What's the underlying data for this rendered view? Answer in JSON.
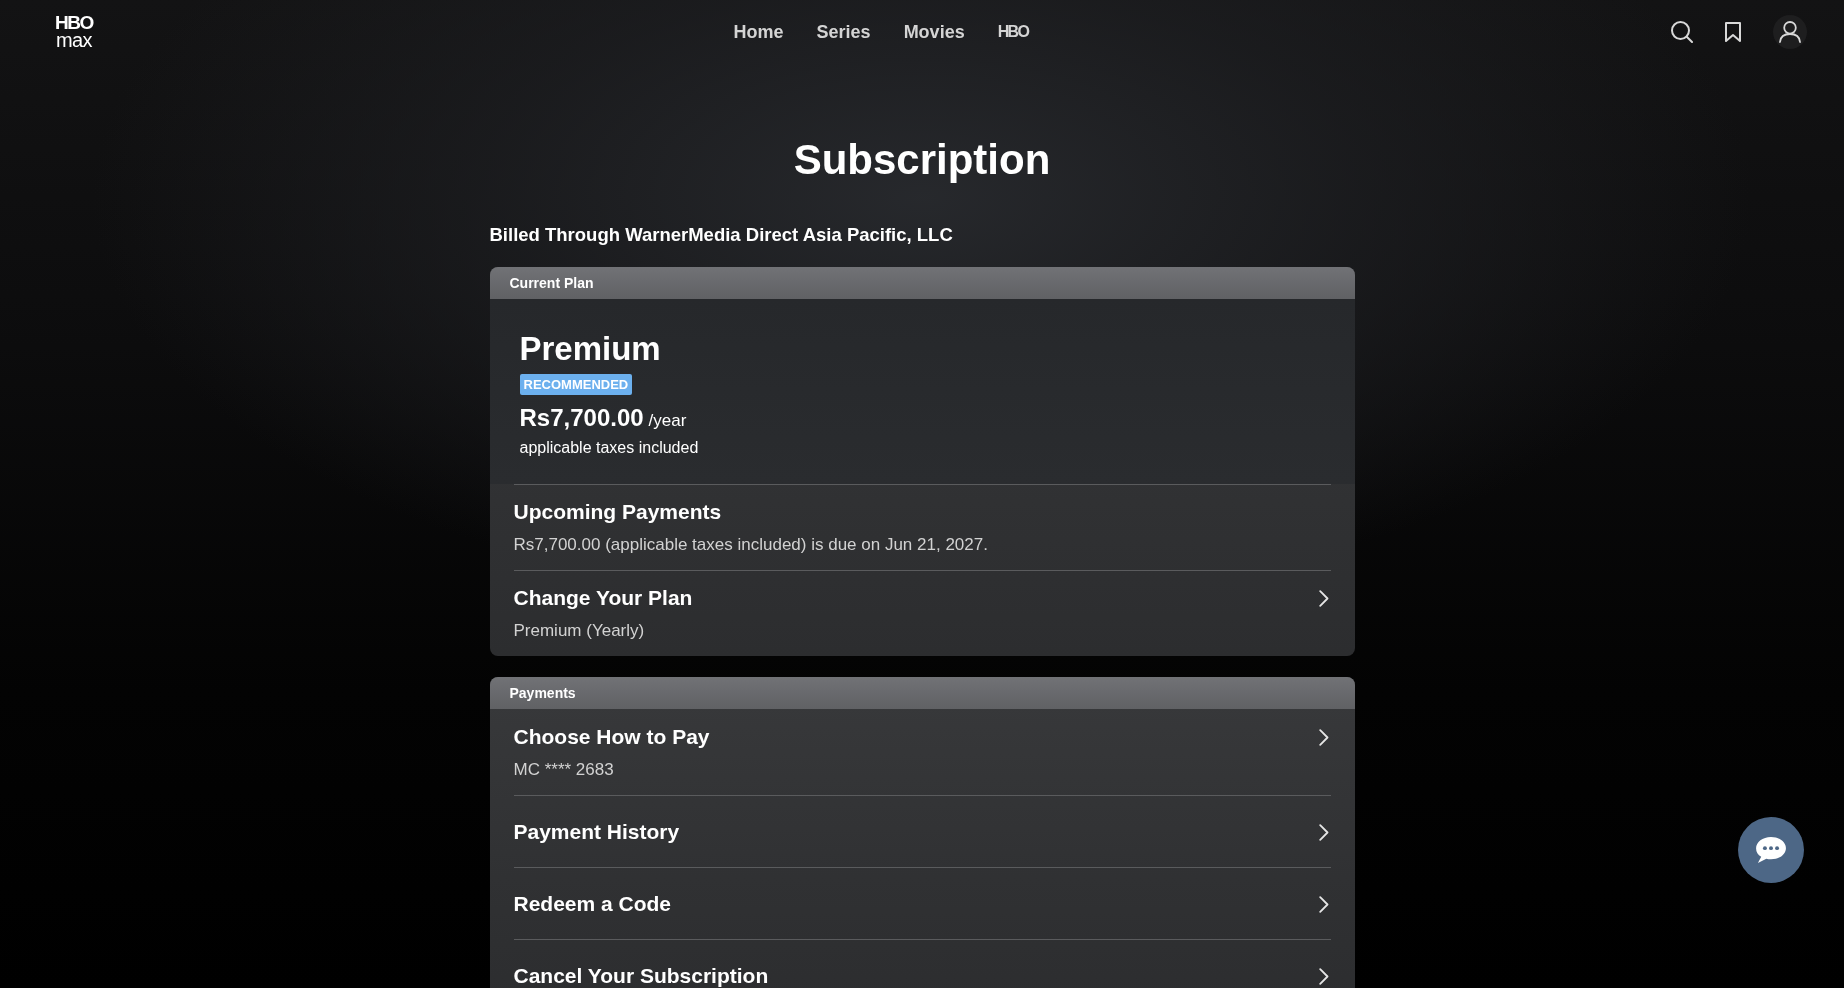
{
  "header": {
    "logo": {
      "top": "HBO",
      "bottom": "max"
    },
    "nav": [
      {
        "kind": "text",
        "label": "Home"
      },
      {
        "kind": "text",
        "label": "Series"
      },
      {
        "kind": "text",
        "label": "Movies"
      },
      {
        "kind": "logo",
        "label": "HBO"
      }
    ]
  },
  "title": "Subscription",
  "billed_through": "Billed Through WarnerMedia Direct Asia Pacific, LLC",
  "cards": [
    {
      "header": "Current Plan",
      "plan": {
        "name": "Premium",
        "badge": "RECOMMENDED",
        "price": "Rs7,700.00",
        "period": "/year",
        "note": "applicable taxes included"
      },
      "rows": [
        {
          "kind": "info",
          "title": "Upcoming Payments",
          "detail": "Rs7,700.00 (applicable taxes included) is due on Jun 21, 2027."
        },
        {
          "kind": "link",
          "title": "Change Your Plan",
          "detail": "Premium (Yearly)"
        }
      ]
    },
    {
      "header": "Payments",
      "rows": [
        {
          "kind": "link",
          "title": "Choose How to Pay",
          "detail": "MC **** 2683"
        },
        {
          "kind": "link",
          "title": "Payment History"
        },
        {
          "kind": "link",
          "title": "Redeem a Code"
        },
        {
          "kind": "link",
          "title": "Cancel Your Subscription"
        }
      ]
    }
  ]
}
